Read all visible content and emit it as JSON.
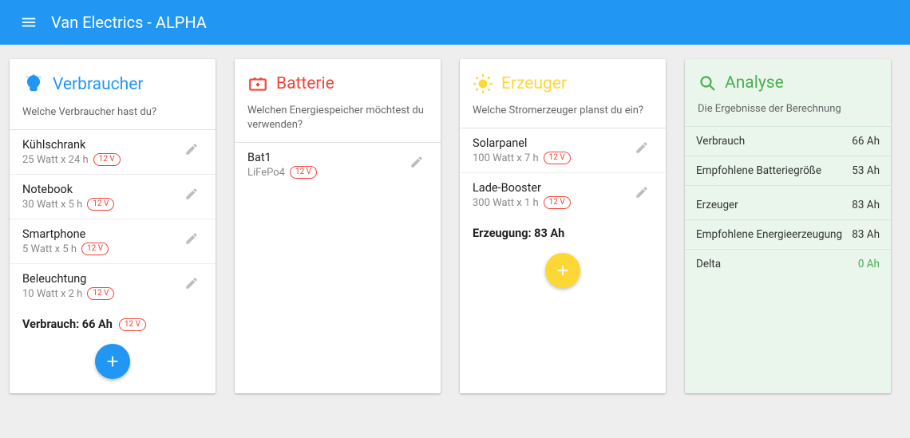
{
  "app": {
    "title": "Van Electrics - ALPHA"
  },
  "badge12v": "12 V",
  "cards": {
    "verbraucher": {
      "title": "Verbraucher",
      "subtitle": "Welche Verbraucher hast du?",
      "items": [
        {
          "name": "Kühlschrank",
          "detail": "25 Watt x 24 h"
        },
        {
          "name": "Notebook",
          "detail": "30 Watt x 5 h"
        },
        {
          "name": "Smartphone",
          "detail": "5 Watt x 5 h"
        },
        {
          "name": "Beleuchtung",
          "detail": "10 Watt x 2 h"
        }
      ],
      "summary": "Verbrauch: 66 Ah"
    },
    "batterie": {
      "title": "Batterie",
      "subtitle": "Welchen Energiespeicher möchtest du verwenden?",
      "items": [
        {
          "name": "Bat1",
          "detail": "LiFePo4"
        }
      ]
    },
    "erzeuger": {
      "title": "Erzeuger",
      "subtitle": "Welche Stromerzeuger planst du ein?",
      "items": [
        {
          "name": "Solarpanel",
          "detail": "100 Watt x 7 h"
        },
        {
          "name": "Lade-Booster",
          "detail": "300 Watt x 1 h"
        }
      ],
      "summary": "Erzeugung: 83 Ah"
    },
    "analyse": {
      "title": "Analyse",
      "subtitle": "Die Ergebnisse der Berechnung",
      "rows": [
        {
          "label": "Verbrauch",
          "value": "66 Ah"
        },
        {
          "label": "Empfohlene Batteriegröße",
          "value": "53 Ah"
        },
        {
          "label": "Erzeuger",
          "value": "83 Ah"
        },
        {
          "label": "Empfohlene Energieerzeugung",
          "value": "83 Ah"
        },
        {
          "label": "Delta",
          "value": "0 Ah"
        }
      ]
    }
  }
}
